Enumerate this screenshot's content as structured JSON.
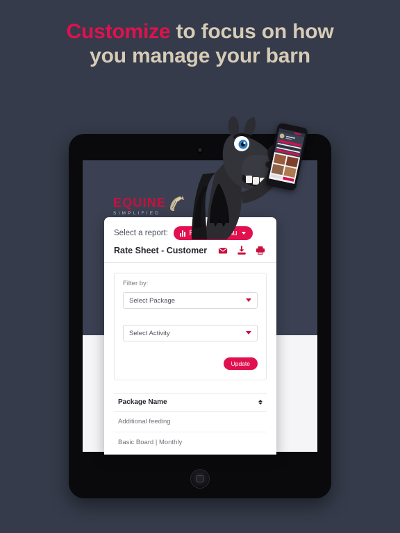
{
  "headline": {
    "accent_word": "Customize",
    "line1_rest": " to focus on how",
    "line2": "you manage your barn",
    "accent_color": "#e0114e",
    "text_color": "#d6cbb6"
  },
  "page": {
    "background_color": "#353b4a"
  },
  "device": {
    "type": "tablet",
    "camera": "camera-dot",
    "home_button": "home-button"
  },
  "app": {
    "logo": {
      "word": "EQUINE",
      "subtitle": "SIMPLIFIED",
      "word_color": "#c8103f",
      "subtitle_color": "#b9bcc6",
      "mark": "horse-head-mark",
      "mark_color": "#c9b78e"
    },
    "header_background": "#3b4152",
    "report_card": {
      "select_label": "Select a report:",
      "reports_menu": {
        "label": "Reports Menu",
        "icon": "bar-chart-icon",
        "caret": "chevron-down-icon",
        "color": "#e0114e"
      },
      "report_title": "Rate Sheet - Customer",
      "actions": [
        {
          "name": "email-icon",
          "title": "Email"
        },
        {
          "name": "download-icon",
          "title": "Download"
        },
        {
          "name": "print-icon",
          "title": "Print"
        }
      ],
      "action_color": "#c8103f",
      "filter": {
        "label": "Filter by:",
        "selects": [
          {
            "name": "package-select",
            "value": "Select Package"
          },
          {
            "name": "activity-select",
            "value": "Select Activity"
          }
        ],
        "update_label": "Update"
      },
      "table": {
        "columns": [
          "Package Name"
        ],
        "sort_icon": "sort-updown-icon",
        "rows": [
          "Additional feeding",
          "Basic Board | Monthly"
        ]
      }
    }
  },
  "mascot": {
    "name": "cartoon-horse-mascot",
    "holds": "smartphone"
  }
}
